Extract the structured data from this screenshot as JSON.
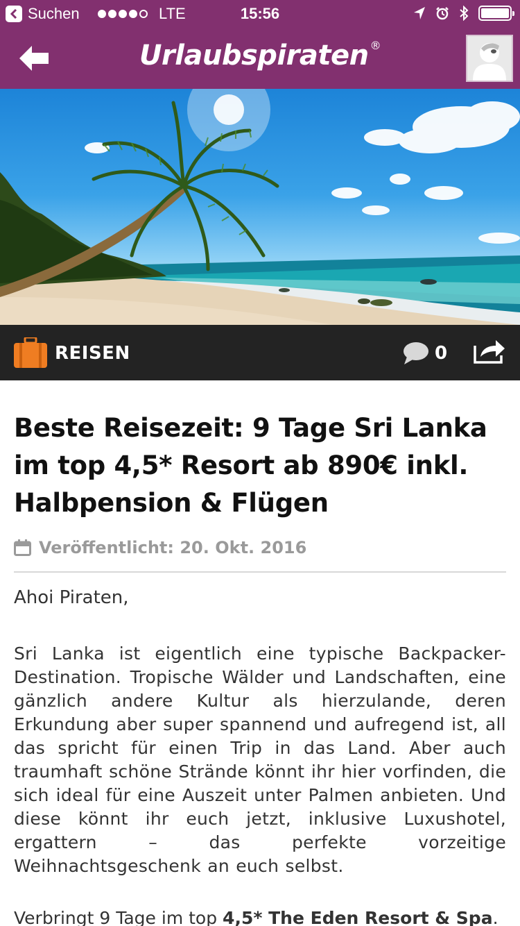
{
  "status_bar": {
    "back_app": "Suchen",
    "network": "LTE",
    "time": "15:56"
  },
  "nav": {
    "brand": "Urlaubspiraten",
    "brand_mark": "®"
  },
  "category": {
    "label": "REISEN",
    "comment_count": "0"
  },
  "article": {
    "title": "Beste Reisezeit: 9 Tage Sri Lanka im top 4,5* Resort ab 890€ inkl. Halbpension & Flügen",
    "published": "Veröffentlicht: 20. Okt. 2016",
    "greeting": "Ahoi Piraten,",
    "paragraph_1": "Sri Lanka ist eigentlich eine typische Backpacker-Destination. Tropische Wälder und Landschaften, eine gänzlich andere Kultur als hierzulande, deren Erkundung aber super spannend und aufregend ist, all das spricht für einen Trip in das Land. Aber auch traumhaft schöne Strände könnt ihr hier vorfinden, die sich ideal für eine Auszeit unter Palmen anbieten. Und diese könnt ihr euch jetzt, inklusive Luxushotel, ergattern – das perfekte vorzeitige Weihnachtsgeschenk an euch selbst.",
    "paragraph_2_start": "Verbringt 9 Tage im top ",
    "paragraph_2_bold": "4,5* The Eden Resort & Spa",
    "paragraph_2_end": "."
  },
  "colors": {
    "brand_purple": "#82306f",
    "category_bar": "#232323",
    "suitcase_orange": "#ef7d22"
  },
  "icons": [
    "back-arrow-icon",
    "user-avatar-icon",
    "suitcase-icon",
    "comment-icon",
    "share-icon",
    "calendar-icon"
  ]
}
